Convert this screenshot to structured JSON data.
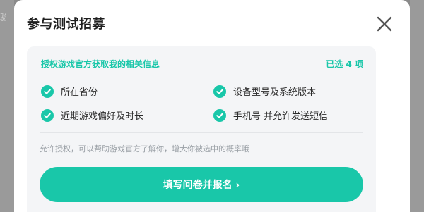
{
  "dialog": {
    "title": "参与测试招募",
    "close_icon": "close-icon"
  },
  "panel": {
    "heading": "授权游戏官方获取我的相关信息",
    "selected_count": "已选 4 项",
    "permissions": [
      {
        "label": "所在省份",
        "checked": true
      },
      {
        "label": "设备型号及系统版本",
        "checked": true
      },
      {
        "label": "近期游戏偏好及时长",
        "checked": true
      },
      {
        "label": "手机号 并允许发送短信",
        "checked": true
      }
    ],
    "hint": "允许授权，可以帮助游戏官方了解你，增大你被选中的概率哦"
  },
  "cta": {
    "label": "填写问卷并报名 ›"
  },
  "background": {
    "fragment": "验"
  },
  "colors": {
    "accent": "#19c7a9",
    "panel_bg": "#f4f5f7"
  }
}
